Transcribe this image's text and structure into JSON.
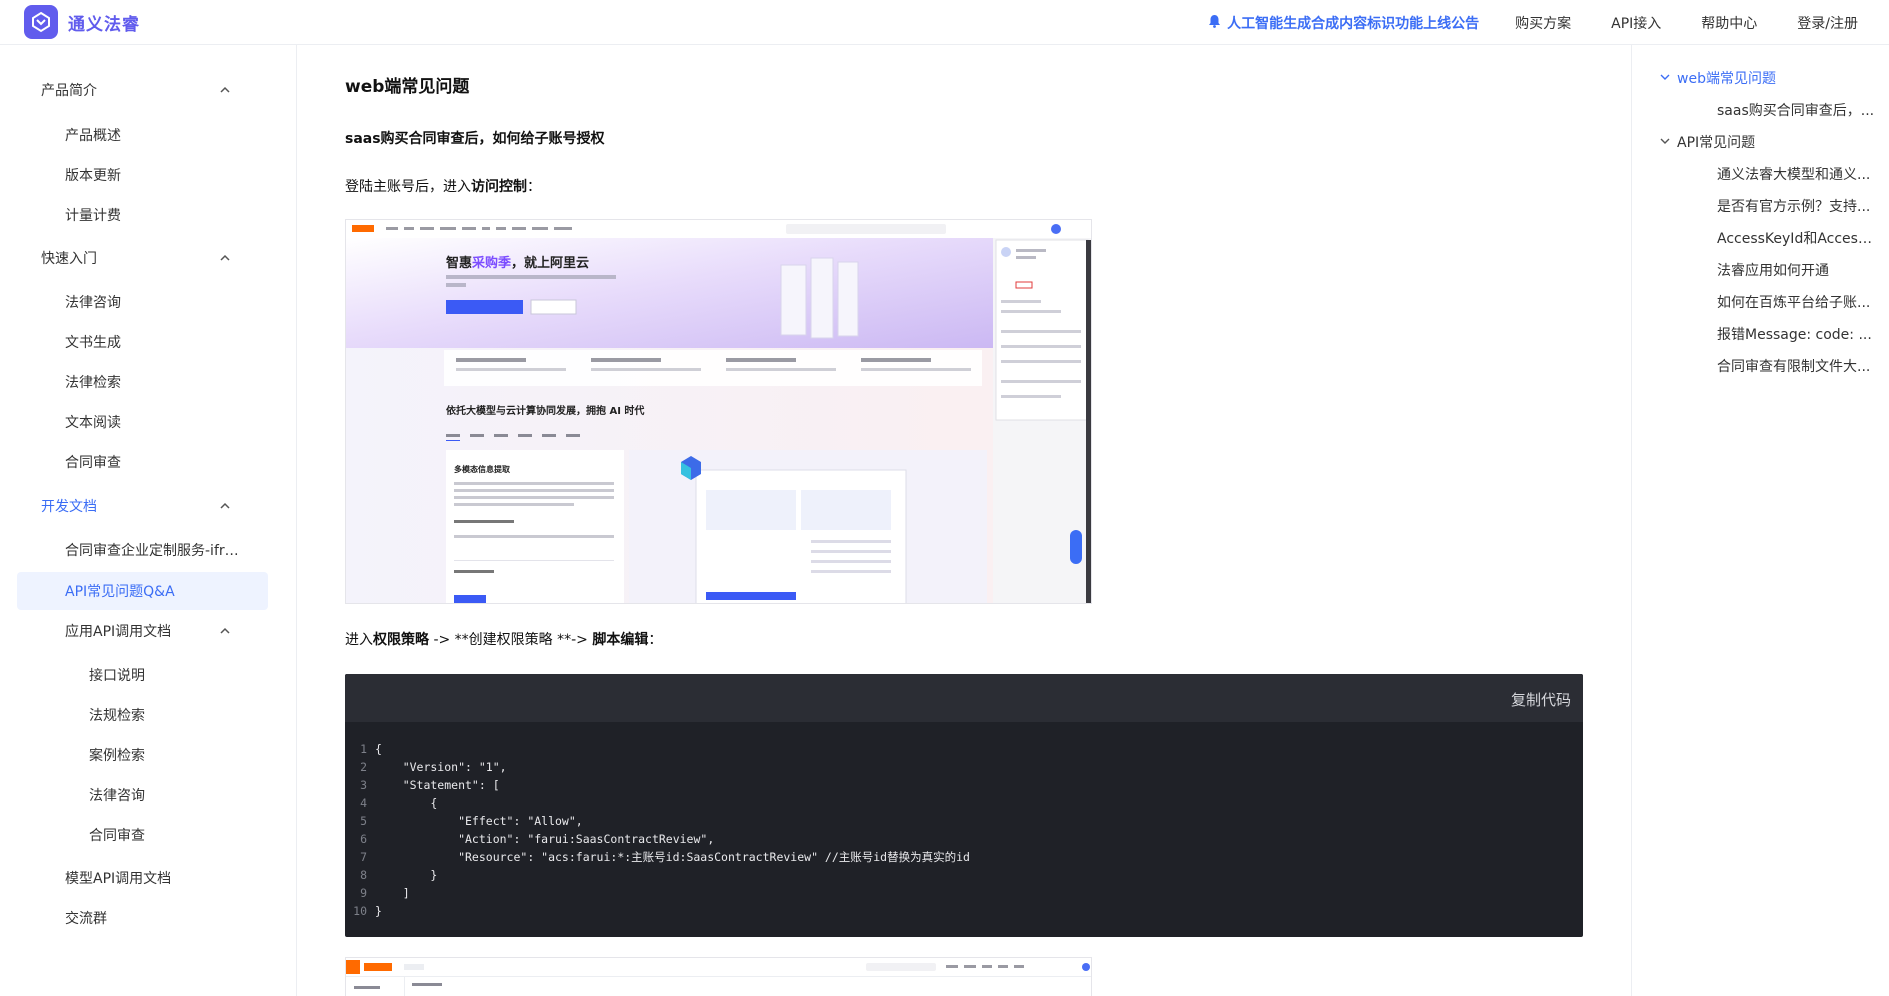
{
  "header": {
    "brand": "通义法睿",
    "announcement": "人工智能生成合成内容标识功能上线公告",
    "nav": [
      "购买方案",
      "API接入",
      "帮助中心",
      "登录/注册"
    ]
  },
  "sidebar": {
    "items": [
      {
        "label": "产品简介",
        "level": 0,
        "expanded": true
      },
      {
        "label": "产品概述",
        "level": 1
      },
      {
        "label": "版本更新",
        "level": 1
      },
      {
        "label": "计量计费",
        "level": 1
      },
      {
        "label": "快速入门",
        "level": 0,
        "expanded": true
      },
      {
        "label": "法律咨询",
        "level": 1
      },
      {
        "label": "文书生成",
        "level": 1
      },
      {
        "label": "法律检索",
        "level": 1
      },
      {
        "label": "文本阅读",
        "level": 1
      },
      {
        "label": "合同审查",
        "level": 1
      },
      {
        "label": "开发文档",
        "level": 0,
        "expanded": true,
        "active": true
      },
      {
        "label": "合同审查企业定制服务-ifra...",
        "level": 1
      },
      {
        "label": "API常见问题Q&A",
        "level": 1,
        "selected": true
      },
      {
        "label": "应用API调用文档",
        "level": 1,
        "expanded": true
      },
      {
        "label": "接口说明",
        "level": 2
      },
      {
        "label": "法规检索",
        "level": 2
      },
      {
        "label": "案例检索",
        "level": 2
      },
      {
        "label": "法律咨询",
        "level": 2
      },
      {
        "label": "合同审查",
        "level": 2
      },
      {
        "label": "模型API调用文档",
        "level": 1
      },
      {
        "label": "交流群",
        "level": 1
      }
    ]
  },
  "main": {
    "title": "web端常见问题",
    "question": "saas购买合同审查后，如何给子账号授权",
    "step1_prefix": "登陆主账号后，进入",
    "step1_bold": "访问控制",
    "step1_suffix": "：",
    "step2_prefix": "进入",
    "step2_bold1": "权限策略",
    "step2_mid": " -> **创建权限策略 **-> ",
    "step2_bold2": "脚本编辑",
    "step2_suffix": "：",
    "copy_label": "复制代码",
    "code_lines": [
      "{",
      "    \"Version\": \"1\",",
      "    \"Statement\": [",
      "        {",
      "            \"Effect\": \"Allow\",",
      "            \"Action\": \"farui:SaasContractReview\",",
      "            \"Resource\": \"acs:farui:*:主账号id:SaasContractReview\" //主账号id替换为真实的id",
      "        }",
      "    ]",
      "}"
    ],
    "screenshot1": {
      "banner_title_a": "智惠",
      "banner_title_b": "采购季",
      "banner_title_c": "，就上阿里云",
      "section_title": "依托大模型与云计算协同发展，拥抱 AI 时代",
      "card_title": "多模态信息提取"
    }
  },
  "toc": {
    "items": [
      {
        "label": "web端常见问题",
        "level": 0,
        "active": true
      },
      {
        "label": "saas购买合同审查后，...",
        "level": 1
      },
      {
        "label": "API常见问题",
        "level": 0
      },
      {
        "label": "通义法睿大模型和通义...",
        "level": 1
      },
      {
        "label": "是否有官方示例？支持...",
        "level": 1
      },
      {
        "label": "AccessKeyId和Access...",
        "level": 1
      },
      {
        "label": "法睿应用如何开通",
        "level": 1
      },
      {
        "label": "如何在百炼平台给子账...",
        "level": 1
      },
      {
        "label": "报错Message: code: ...",
        "level": 1
      },
      {
        "label": "合同审查有限制文件大...",
        "level": 1
      }
    ]
  },
  "colors": {
    "brand": "#615ced",
    "accent": "#3b6df5",
    "code_bg": "#1f2127"
  }
}
